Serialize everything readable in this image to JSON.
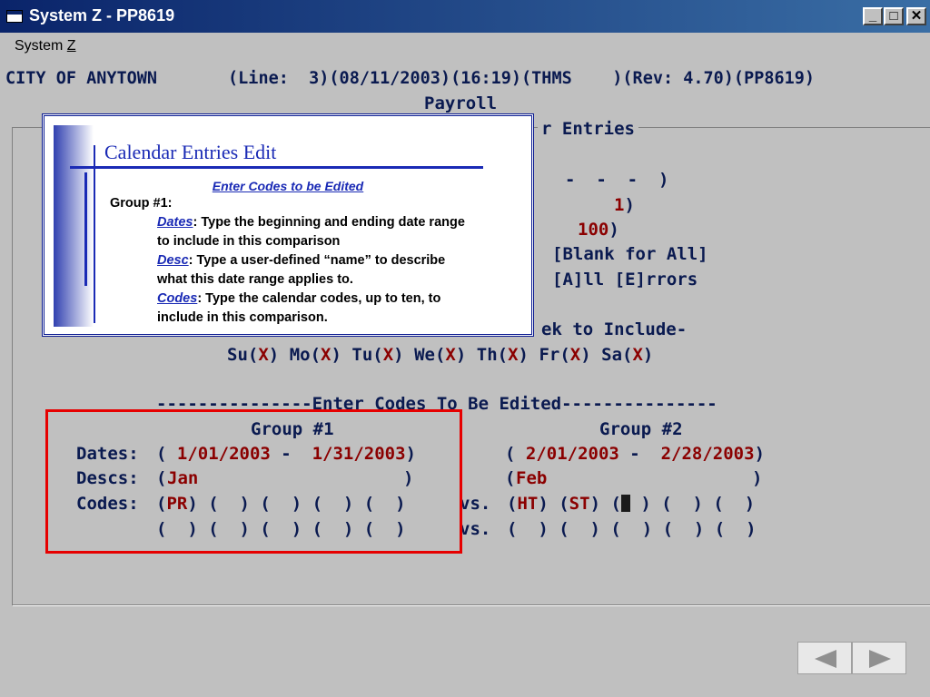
{
  "window": {
    "title": "System Z - PP8619",
    "minimize_label": "_",
    "maximize_label": "□",
    "close_label": "✕"
  },
  "menu": {
    "system_prefix": "System ",
    "system_mnemonic": "Z"
  },
  "header": {
    "status_line": "CITY OF ANYTOWN       (Line:  3)(08/11/2003)(16:19)(THMS    )(Rev: 4.70)(PP8619)",
    "module": "Payroll"
  },
  "screen": {
    "section_title_visible": "r Entries",
    "row_paren_dashes": "-  -  -  )",
    "row1_value": "1",
    "row1_close": ")",
    "row2_value": "100",
    "row2_close": ")",
    "blank_for_all": "[Blank for All]",
    "all_errors": "[A]ll [E]rrors",
    "days_header_visible": "ek to Include-",
    "days": [
      {
        "label": "Su",
        "value": "X"
      },
      {
        "label": "Mo",
        "value": "X"
      },
      {
        "label": "Tu",
        "value": "X"
      },
      {
        "label": "We",
        "value": "X"
      },
      {
        "label": "Th",
        "value": "X"
      },
      {
        "label": "Fr",
        "value": "X"
      },
      {
        "label": "Sa",
        "value": "X"
      }
    ],
    "codes_divider": "---------------Enter Codes To Be Edited---------------",
    "group1_label": "Group #1",
    "group2_label": "Group #2",
    "dates_label": "Dates:",
    "descs_label": "Descs:",
    "codes_label": "Codes:",
    "vs_label": "vs.",
    "group1": {
      "date_from": " 1/01/2003",
      "date_to": " 1/31/2003",
      "desc": "Jan",
      "codes_row1": [
        "PR",
        "",
        "",
        "",
        ""
      ],
      "codes_row2": [
        "",
        "",
        "",
        "",
        ""
      ]
    },
    "group2": {
      "date_from": " 2/01/2003",
      "date_to": " 2/28/2003",
      "desc": "Feb",
      "codes_row1": [
        "HT",
        "ST",
        "",
        "",
        ""
      ],
      "codes_row2": [
        "",
        "",
        "",
        "",
        ""
      ]
    }
  },
  "callout": {
    "title": "Calendar Entries Edit",
    "subtitle": "Enter Codes to be Edited",
    "group_label": "Group #1:",
    "dates_kw": "Dates",
    "dates_text1": ":  Type the beginning and ending date range",
    "dates_text2": "to include in this comparison",
    "desc_kw": "Desc",
    "desc_text1": ":  Type a user-defined “name” to describe",
    "desc_text2": "what this date range applies to.",
    "codes_kw": "Codes",
    "codes_text1": ":  Type the calendar codes, up to ten, to",
    "codes_text2": "include in this comparison."
  },
  "nav": {
    "back_icon": "triangle-left-icon",
    "forward_icon": "triangle-right-icon"
  },
  "colors": {
    "field_value": "#8b0000",
    "label_text": "#0a1a50",
    "highlight_box": "#e60000",
    "callout_accent": "#1a2ab5"
  }
}
